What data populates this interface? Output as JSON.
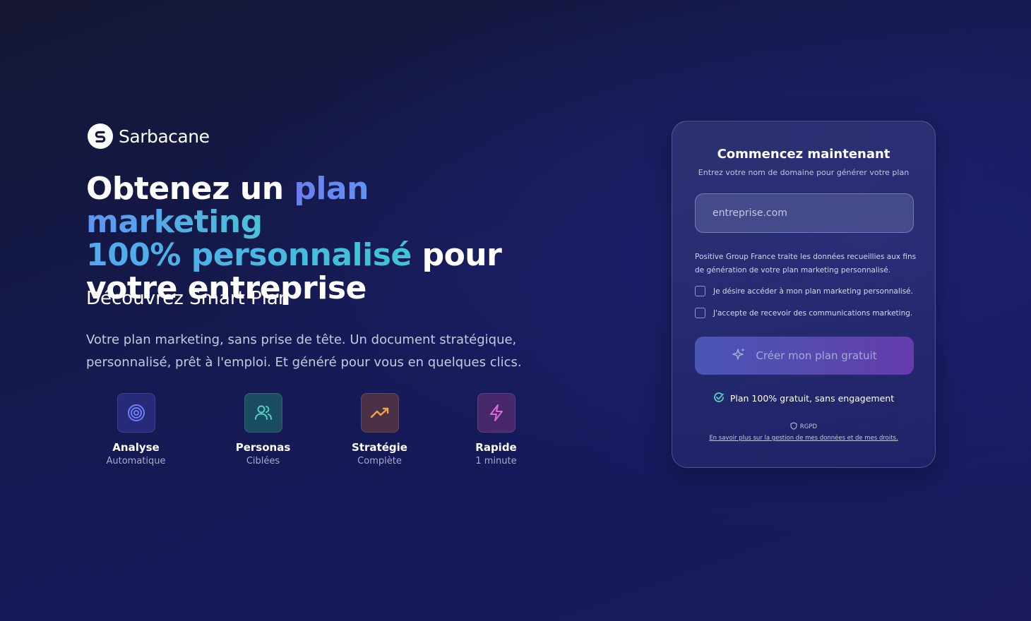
{
  "brand": {
    "name": "Sarbacane",
    "logo_icon": "sarbacane-s-logo-icon"
  },
  "hero": {
    "headline_part1": "Obtenez un ",
    "headline_highlight1": "plan marketing",
    "headline_highlight2": "100% personnalisé",
    "headline_part2": " pour",
    "headline_part3": "votre entreprise",
    "subtitle": "Découvrez Smart Plan",
    "description": "Votre plan marketing, sans prise de tête. Un document stratégique, personnalisé, prêt à l'emploi. Et généré pour vous en quelques clics."
  },
  "features": [
    {
      "icon": "target-icon",
      "title": "Analyse",
      "subtitle": "Automatique",
      "color": "#6f7ff5"
    },
    {
      "icon": "users-icon",
      "title": "Personas",
      "subtitle": "Ciblées",
      "color": "#4fd1c5"
    },
    {
      "icon": "trending-up-icon",
      "title": "Stratégie",
      "subtitle": "Complète",
      "color": "#f6a04d"
    },
    {
      "icon": "lightning-icon",
      "title": "Rapide",
      "subtitle": "1 minute",
      "color": "#d96bd6"
    }
  ],
  "form": {
    "title": "Commencez maintenant",
    "subtitle": "Entrez votre nom de domaine pour générer votre plan",
    "domain_placeholder": "entreprise.com",
    "privacy_text": "Positive Group France traite les données recueillies aux fins de génération de votre plan marketing personnalisé.",
    "checkbox_plan_label": "Je désire accéder à mon plan marketing personnalisé.",
    "checkbox_marketing_label": "J'accepte de recevoir des communications marketing.",
    "cta_label": "Créer mon plan gratuit",
    "free_note": "Plan 100% gratuit, sans engagement",
    "rgpd_label": "RGPD",
    "rgpd_link": "En savoir plus sur la gestion de mes données et de mes droits."
  },
  "colors": {
    "background": "#15195a",
    "accent_blue": "#6b7ef0",
    "accent_teal": "#49c3d6",
    "cta_start": "#4c59b8",
    "cta_end": "#6a3db0"
  }
}
